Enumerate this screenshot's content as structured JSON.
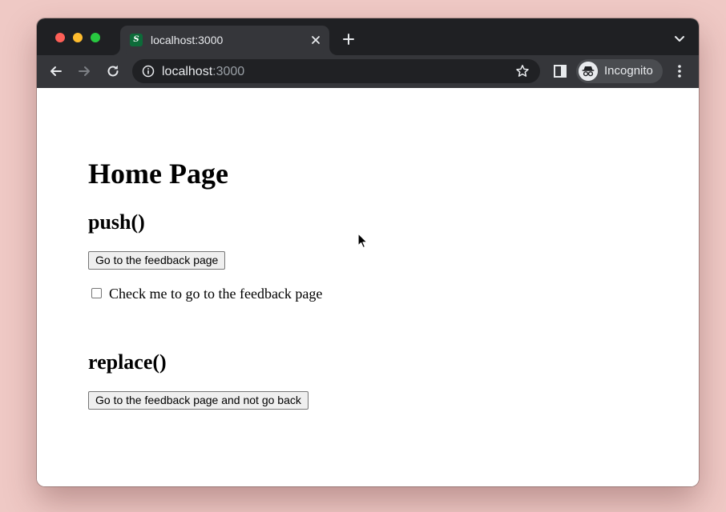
{
  "browser": {
    "tab": {
      "favicon_letter": "S",
      "title": "localhost:3000"
    },
    "address_bar": {
      "host": "localhost",
      "port": ":3000"
    },
    "profile_label": "Incognito",
    "colors": {
      "tab_strip": "#1f2023",
      "toolbar": "#35363a",
      "omnibox": "#202124",
      "favicon": "#0d6b39"
    },
    "icons": [
      "close-icon",
      "plus-icon",
      "chevron-down-icon",
      "back-arrow-icon",
      "forward-arrow-icon",
      "reload-icon",
      "info-icon",
      "star-icon",
      "side-panel-icon",
      "incognito-icon",
      "kebab-menu-icon"
    ]
  },
  "page": {
    "title": "Home Page",
    "push": {
      "heading": "push()",
      "button_label": "Go to the feedback page",
      "checkbox_label": "Check me to go to the feedback page",
      "checkbox_checked": false
    },
    "replace": {
      "heading": "replace()",
      "button_label": "Go to the feedback page and not go back"
    }
  }
}
